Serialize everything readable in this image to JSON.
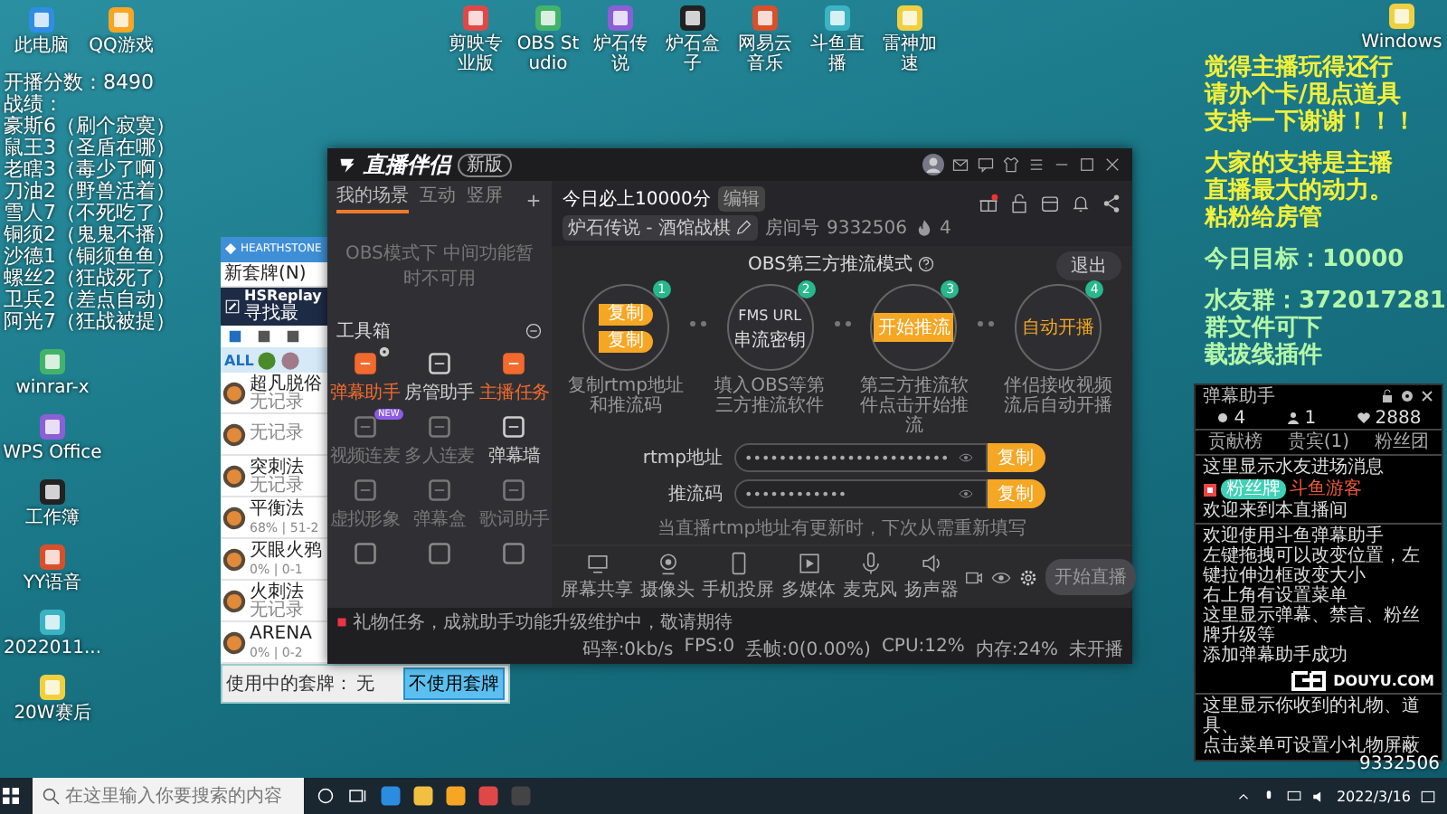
{
  "desktop": {
    "top_icons": [
      {
        "label": "此电脑"
      },
      {
        "label": "QQ游戏"
      }
    ],
    "top_row_icons": [
      {
        "label": "剪映专业版"
      },
      {
        "label": "OBS Studio"
      },
      {
        "label": "炉石传说"
      },
      {
        "label": "炉石盒子"
      },
      {
        "label": "网易云音乐"
      },
      {
        "label": "斗鱼直播"
      },
      {
        "label": "雷神加速"
      }
    ],
    "corner_icon": {
      "label": "Windows"
    },
    "left_icons": [
      {
        "label": "winrar-x"
      },
      {
        "label": "WPS Office"
      },
      {
        "label": "工作簿"
      },
      {
        "label": "YY语音"
      },
      {
        "label": "2022011..."
      },
      {
        "label": "20W赛后"
      }
    ]
  },
  "score_overlay": {
    "score": "开播分数：8490",
    "records_title": "战绩：",
    "records": [
      "豪斯6（刷个寂寞）",
      "鼠王3（圣盾在哪）",
      "老瞎3（毒少了啊）",
      "刀油2（野兽活着）",
      "雪人7（不死吃了）",
      "铜须2（鬼鬼不播）",
      "沙德1（铜须鱼鱼）",
      "螺丝2（狂战死了）",
      "卫兵2（差点自动）",
      "阿光7（狂战被提）"
    ]
  },
  "notice_overlay": {
    "appeal": [
      "觉得主播玩得还行",
      "请办个卡/甩点道具",
      "支持一下谢谢！！！"
    ],
    "support": [
      "大家的支持是主播",
      "直播最大的动力。",
      "粘粉给房管"
    ],
    "goal": "今日目标：10000",
    "group": [
      "水友群：372017281",
      "群文件可下",
      "载拔线插件"
    ]
  },
  "hsreplay": {
    "title": "HEARTHSTONE",
    "menu": "新套牌(N)",
    "banner_title": "HSReplay",
    "banner_sub": "寻找最",
    "filter": "ALL",
    "decks": [
      {
        "name": "超凡脱俗",
        "record": "无记录"
      },
      {
        "record": "无记录"
      },
      {
        "name": "突刺法",
        "record": "无记录"
      },
      {
        "name": "平衡法",
        "record": "68% | 51-2"
      },
      {
        "name": "灭眼火鸦",
        "record": "0% | 0-1"
      },
      {
        "name": "火刺法",
        "record": "无记录"
      },
      {
        "name": "ARENA",
        "record": "0% | 0-2"
      }
    ],
    "active_label": "使用中的套牌：",
    "active_deck": "无",
    "button": "不使用套牌"
  },
  "app": {
    "title": "直播伴侣",
    "version_badge": "新版",
    "scene_tabs": [
      {
        "label": "我的场景",
        "selected": true
      },
      {
        "label": "互动",
        "selected": false
      },
      {
        "label": "竖屏",
        "selected": false
      }
    ],
    "scene_notice": "OBS模式下 中间功能暂时不可用",
    "toolbox_title": "工具箱",
    "tools": [
      {
        "label": "弹幕助手",
        "highlight": true,
        "disabled": false,
        "gear": true
      },
      {
        "label": "房管助手",
        "highlight": false,
        "disabled": false
      },
      {
        "label": "主播任务",
        "highlight": true,
        "disabled": false
      },
      {
        "label": "视频连麦",
        "highlight": false,
        "disabled": true,
        "badge": "NEW"
      },
      {
        "label": "多人连麦",
        "highlight": false,
        "disabled": true
      },
      {
        "label": "弹幕墙",
        "highlight": false,
        "disabled": false
      },
      {
        "label": "虚拟形象",
        "highlight": false,
        "disabled": true
      },
      {
        "label": "弹幕盒",
        "highlight": false,
        "disabled": true
      },
      {
        "label": "歌词助手",
        "highlight": false,
        "disabled": true
      }
    ],
    "room_title": "今日必上10000分",
    "edit_badge": "编辑",
    "category": "炉石传说 - 酒馆战棋",
    "room_label": "房间号",
    "room_number": "9332506",
    "heat": "4",
    "mode_title": "OBS第三方推流模式",
    "exit_button": "退出",
    "steps": [
      {
        "kind": "copy",
        "number": "1",
        "buttons": [
          "复制",
          "复制"
        ],
        "caption": "复制rtmp地址和推流码"
      },
      {
        "kind": "fields",
        "number": "2",
        "lines": [
          "FMS URL",
          "串流密钥"
        ],
        "caption": "填入OBS等第三方推流软件"
      },
      {
        "kind": "start",
        "number": "3",
        "button": "开始推流",
        "caption": "第三方推流软件点击开始推流"
      },
      {
        "kind": "auto",
        "number": "4",
        "text": "自动开播",
        "caption": "伴侣接收视频流后自动开播"
      }
    ],
    "fields": [
      {
        "label": "rtmp地址",
        "value": "••••••••••••••••••••••••",
        "button": "复制"
      },
      {
        "label": "推流码",
        "value": "••••••••••••",
        "button": "复制"
      }
    ],
    "field_note": "当直播rtmp地址有更新时，下次从需重新填写",
    "toolbar": [
      {
        "label": "屏幕共享",
        "kind": "screen"
      },
      {
        "label": "摄像头",
        "kind": "camera"
      },
      {
        "label": "手机投屏",
        "kind": "phone"
      },
      {
        "label": "多媒体",
        "kind": "media"
      },
      {
        "label": "麦克风",
        "kind": "mic"
      },
      {
        "label": "扬声器",
        "kind": "speaker"
      }
    ],
    "start_button": "开始直播",
    "status_message": "礼物任务，成就助手功能升级维护中，敬请期待",
    "stats": [
      "码率:0kb/s",
      "FPS:0",
      "丢帧:0(0.00%)",
      "CPU:12%",
      "内存:24%",
      "未开播"
    ]
  },
  "danmu": {
    "title": "弹幕助手",
    "viewers": "4",
    "fans": "1",
    "likes": "2888",
    "tabs": [
      "贡献榜",
      "贵宾(1)",
      "粉丝团"
    ],
    "entry_hint": "这里显示水友进场消息",
    "welcome_badge": "粉丝牌",
    "welcome_user": "斗鱼游客",
    "welcome_text": "欢迎来到本直播间",
    "messages": [
      "欢迎使用斗鱼弹幕助手",
      "左键拖拽可以改变位置，左键拉伸边框改变大小",
      "右上角有设置菜单",
      "这里显示弹幕、禁言、粉丝牌升级等",
      "添加弹幕助手成功"
    ],
    "gift_notes": [
      "这里显示你收到的礼物、道具、",
      "点击菜单可设置小礼物屏蔽"
    ],
    "logo_text": "DOUYU.COM"
  },
  "room_overlay": "9332506",
  "taskbar": {
    "search_placeholder": "在这里输入你要搜索的内容",
    "date": "2022/3/16"
  }
}
